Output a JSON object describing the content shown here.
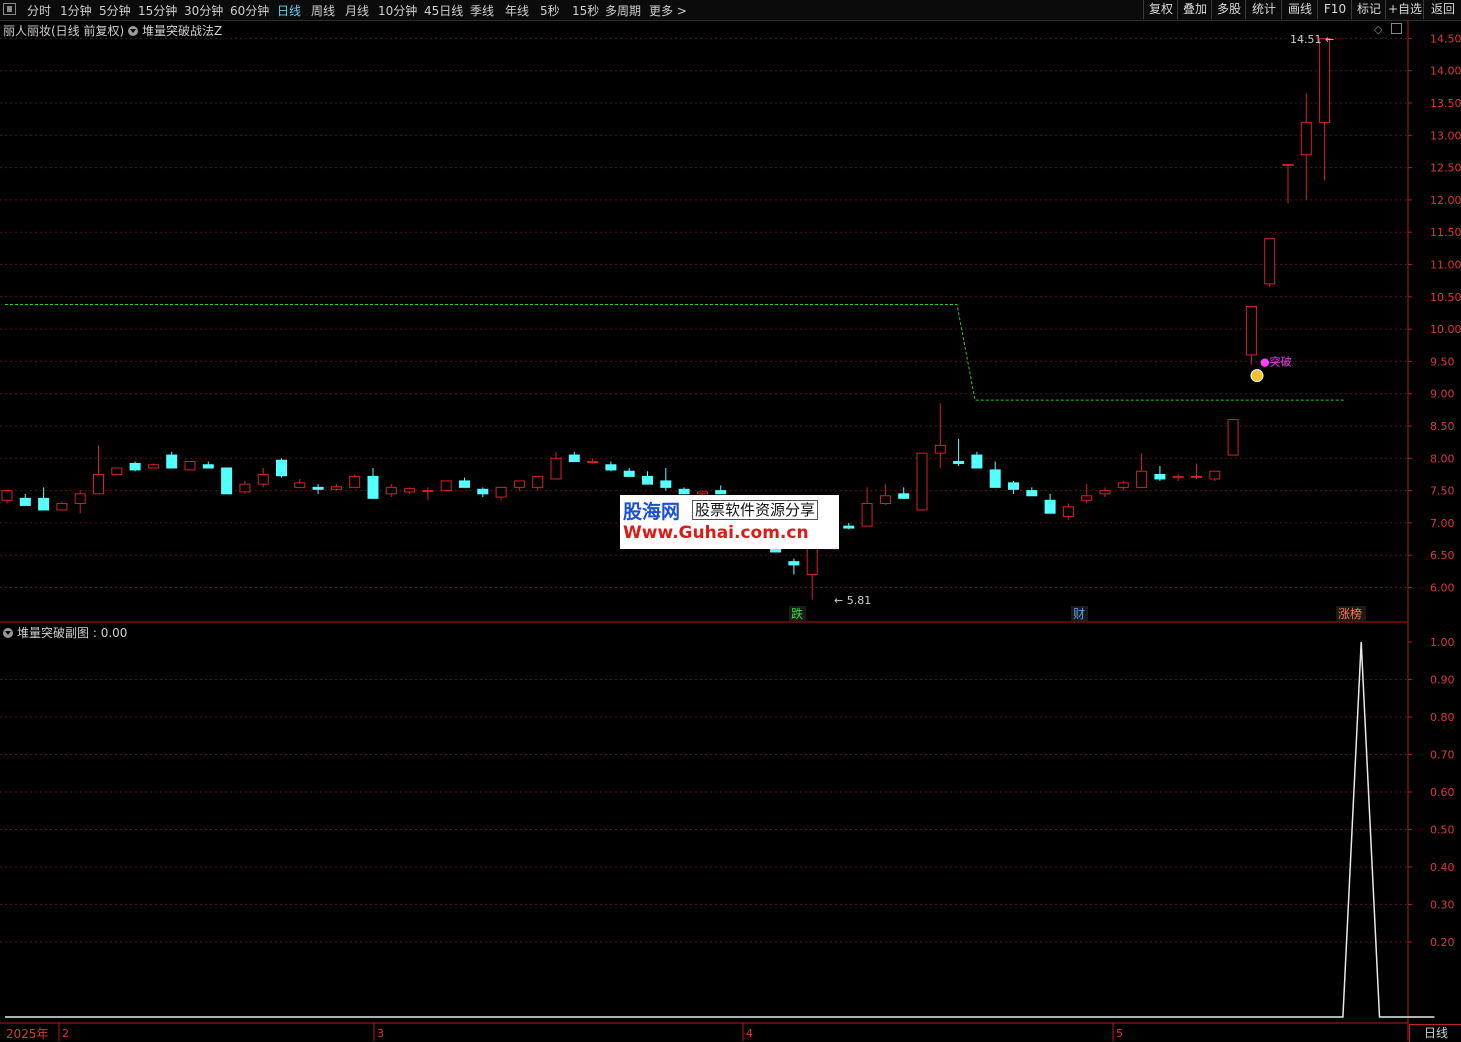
{
  "toolbar": {
    "periods": [
      "分时",
      "1分钟",
      "5分钟",
      "15分钟",
      "30分钟",
      "60分钟",
      "日线",
      "周线",
      "月线",
      "10分钟",
      "45日线",
      "季线",
      "年线",
      "5秒",
      "15秒",
      "多周期",
      "更多 >"
    ],
    "active_period": "日线",
    "buttons": [
      "复权",
      "叠加",
      "多股",
      "统计",
      "画线",
      "F10",
      "标记",
      "+自选",
      "返回"
    ]
  },
  "main_panel": {
    "stock_title": "丽人丽妆(日线 前复权)",
    "indicator_name": "堆量突破战法Z",
    "price_axis": [
      "14.50",
      "14.00",
      "13.50",
      "13.00",
      "12.50",
      "12.00",
      "11.50",
      "11.00",
      "10.50",
      "10.00",
      "9.50",
      "9.00",
      "8.50",
      "8.00",
      "7.50",
      "7.00",
      "6.50",
      "6.00"
    ],
    "high_annotation": "14.51",
    "low_annotation": "5.81",
    "signal_label": "突破",
    "event_markers": [
      {
        "text": "跌",
        "color": "#3ddc3d"
      },
      {
        "text": "财",
        "color": "#4fa0ff"
      },
      {
        "text": "涨榜",
        "color": "#ff7a3d"
      }
    ]
  },
  "sub_panel": {
    "title": "堆量突破副图",
    "value": "0.00",
    "axis": [
      "1.00",
      "0.90",
      "0.80",
      "0.70",
      "0.60",
      "0.50",
      "0.40",
      "0.30",
      "0.20"
    ],
    "series": [
      0,
      0,
      0,
      0,
      0,
      0,
      0,
      0,
      0,
      0,
      0,
      0,
      0,
      0,
      0,
      0,
      0,
      0,
      0,
      0,
      0,
      0,
      0,
      0,
      0,
      0,
      0,
      0,
      0,
      0,
      0,
      0,
      0,
      0,
      0,
      0,
      0,
      0,
      0,
      0,
      0,
      0,
      0,
      0,
      0,
      0,
      0,
      0,
      0,
      0,
      0,
      0,
      0,
      0,
      0,
      0,
      0,
      0,
      0,
      0,
      0,
      0,
      0,
      0,
      0,
      0,
      0,
      0,
      0,
      0,
      0,
      0,
      0,
      0,
      1,
      0,
      0,
      0,
      0
    ]
  },
  "candles": [
    [
      7.35,
      7.5,
      7.3,
      7.5
    ],
    [
      7.38,
      7.45,
      7.27,
      7.27
    ],
    [
      7.38,
      7.55,
      7.2,
      7.2
    ],
    [
      7.2,
      7.33,
      7.2,
      7.3
    ],
    [
      7.3,
      7.5,
      7.15,
      7.45
    ],
    [
      7.45,
      8.2,
      7.45,
      7.75
    ],
    [
      7.75,
      7.85,
      7.75,
      7.85
    ],
    [
      7.92,
      7.95,
      7.8,
      7.82
    ],
    [
      7.85,
      7.92,
      7.85,
      7.9
    ],
    [
      8.05,
      8.1,
      7.85,
      7.85
    ],
    [
      7.82,
      7.95,
      7.82,
      7.95
    ],
    [
      7.9,
      7.95,
      7.85,
      7.85
    ],
    [
      7.85,
      7.85,
      7.45,
      7.45
    ],
    [
      7.48,
      7.65,
      7.45,
      7.6
    ],
    [
      7.6,
      7.85,
      7.55,
      7.75
    ],
    [
      7.97,
      8.0,
      7.7,
      7.73
    ],
    [
      7.55,
      7.68,
      7.55,
      7.62
    ],
    [
      7.55,
      7.6,
      7.45,
      7.52
    ],
    [
      7.52,
      7.6,
      7.5,
      7.56
    ],
    [
      7.55,
      7.75,
      7.55,
      7.72
    ],
    [
      7.72,
      7.85,
      7.38,
      7.38
    ],
    [
      7.45,
      7.6,
      7.4,
      7.55
    ],
    [
      7.48,
      7.55,
      7.45,
      7.53
    ],
    [
      7.5,
      7.55,
      7.35,
      7.5
    ],
    [
      7.5,
      7.65,
      7.5,
      7.65
    ],
    [
      7.65,
      7.7,
      7.55,
      7.55
    ],
    [
      7.52,
      7.55,
      7.4,
      7.45
    ],
    [
      7.4,
      7.55,
      7.35,
      7.55
    ],
    [
      7.55,
      7.65,
      7.5,
      7.65
    ],
    [
      7.55,
      7.7,
      7.5,
      7.72
    ],
    [
      7.68,
      8.1,
      7.68,
      8.0
    ],
    [
      8.05,
      8.1,
      7.95,
      7.95
    ],
    [
      7.95,
      8.0,
      7.92,
      7.95
    ],
    [
      7.9,
      7.95,
      7.8,
      7.82
    ],
    [
      7.8,
      7.85,
      7.72,
      7.72
    ],
    [
      7.72,
      7.8,
      7.6,
      7.6
    ],
    [
      7.65,
      7.85,
      7.5,
      7.55
    ],
    [
      7.52,
      7.55,
      7.45,
      7.45
    ],
    [
      7.45,
      7.5,
      7.35,
      7.48
    ],
    [
      7.5,
      7.58,
      7.45,
      7.45
    ],
    [
      7.2,
      7.3,
      7.0,
      7.0
    ],
    [
      7.05,
      7.1,
      6.85,
      6.85
    ],
    [
      6.75,
      6.85,
      6.55,
      6.55
    ],
    [
      6.4,
      6.45,
      6.2,
      6.35
    ],
    [
      6.2,
      6.75,
      5.81,
      6.62
    ],
    [
      6.6,
      7.0,
      6.6,
      7.0
    ],
    [
      6.95,
      7.0,
      6.9,
      6.92
    ],
    [
      6.95,
      7.55,
      6.95,
      7.3
    ],
    [
      7.3,
      7.6,
      7.28,
      7.42
    ],
    [
      7.45,
      7.55,
      7.38,
      7.38
    ],
    [
      7.2,
      8.08,
      7.2,
      8.08
    ],
    [
      8.08,
      8.85,
      7.85,
      8.2
    ],
    [
      7.95,
      8.3,
      7.88,
      7.92
    ],
    [
      8.05,
      8.1,
      7.85,
      7.85
    ],
    [
      7.82,
      7.95,
      7.55,
      7.55
    ],
    [
      7.62,
      7.65,
      7.45,
      7.52
    ],
    [
      7.5,
      7.55,
      7.42,
      7.42
    ],
    [
      7.35,
      7.45,
      7.15,
      7.15
    ],
    [
      7.1,
      7.3,
      7.05,
      7.25
    ],
    [
      7.35,
      7.6,
      7.3,
      7.42
    ],
    [
      7.45,
      7.55,
      7.4,
      7.5
    ],
    [
      7.55,
      7.65,
      7.5,
      7.62
    ],
    [
      7.55,
      8.08,
      7.55,
      7.8
    ],
    [
      7.75,
      7.88,
      7.65,
      7.68
    ],
    [
      7.7,
      7.75,
      7.65,
      7.72
    ],
    [
      7.72,
      7.92,
      7.68,
      7.72
    ],
    [
      7.68,
      7.8,
      7.65,
      7.8
    ],
    [
      8.05,
      8.6,
      8.05,
      8.6
    ],
    [
      9.6,
      10.35,
      9.45,
      10.35
    ],
    [
      10.7,
      11.4,
      10.65,
      11.4
    ],
    [
      12.55,
      12.55,
      11.95,
      12.55
    ],
    [
      12.7,
      13.65,
      12.0,
      13.2
    ],
    [
      13.2,
      14.5,
      12.3,
      14.5
    ]
  ]
}
